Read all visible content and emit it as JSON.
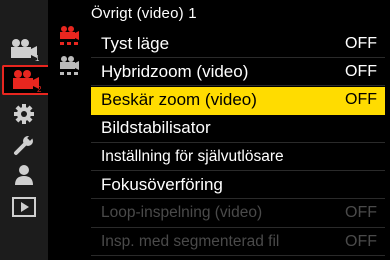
{
  "title": "Övrigt (video) 1",
  "sidebar": {
    "items": [
      {
        "icon": "photo-camera-icon",
        "sub": "1"
      },
      {
        "icon": "video-camera-icon",
        "sub": "2",
        "selected": true
      },
      {
        "icon": "gear-icon"
      },
      {
        "icon": "wrench-icon"
      },
      {
        "icon": "person-icon"
      },
      {
        "icon": "playback-icon"
      }
    ]
  },
  "subtabs": [
    {
      "icon": "video-camera-tab-icon",
      "selected": true
    },
    {
      "icon": "video-camera-tab-icon",
      "selected": false
    }
  ],
  "menu": {
    "items": [
      {
        "label": "Tyst läge",
        "value": "OFF",
        "state": "normal"
      },
      {
        "label": "Hybridzoom (video)",
        "value": "OFF",
        "state": "normal"
      },
      {
        "label": "Beskär zoom (video)",
        "value": "OFF",
        "state": "highlighted"
      },
      {
        "label": "Bildstabilisator",
        "value": "",
        "state": "normal"
      },
      {
        "label": "Inställning för självutlösare",
        "value": "",
        "state": "normal"
      },
      {
        "label": "Fokusöverföring",
        "value": "",
        "state": "normal"
      },
      {
        "label": "Loop-inspelning (video)",
        "value": "OFF",
        "state": "disabled"
      },
      {
        "label": "Insp. med segmenterad fil",
        "value": "OFF",
        "state": "disabled"
      }
    ]
  },
  "colors": {
    "highlight": "#ffdc00",
    "accent_red": "#e8261f",
    "disabled_text": "#4a4a4a",
    "sidebar_bg": "#1c1c1c"
  }
}
